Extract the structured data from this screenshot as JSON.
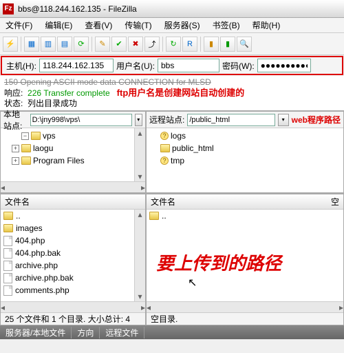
{
  "title": "bbs@118.244.162.135 - FileZilla",
  "menu": [
    "文件(F)",
    "编辑(E)",
    "查看(V)",
    "传输(T)",
    "服务器(S)",
    "书签(B)",
    "帮助(H)"
  ],
  "conn": {
    "host_label": "主机(H):",
    "host": "118.244.162.135",
    "user_label": "用户名(U):",
    "user": "bbs",
    "pass_label": "密码(W):",
    "pass": "●●●●●●●●●●"
  },
  "log": {
    "line1": "150 Opening ASCII mode data CONNECTION for MLSD",
    "line2_label": "响应:",
    "line2": "226 Transfer complete",
    "line3_label": "状态:",
    "line3": "列出目录成功",
    "anno1": "ftp用户名是创建网站自动创建的"
  },
  "local": {
    "label": "本地站点:",
    "path": "D:\\jny998\\vps\\",
    "tree": [
      "vps",
      "laogu",
      "Program Files"
    ]
  },
  "remote": {
    "label": "远程站点:",
    "path": "/public_html",
    "anno": "web程序路径",
    "tree": [
      "logs",
      "public_html",
      "tmp"
    ]
  },
  "filehdr": "文件名",
  "localfiles": [
    "..",
    "images",
    "404.php",
    "404.php.bak",
    "archive.php",
    "archive.php.bak",
    "comments.php"
  ],
  "localstatus": "25 个文件和 1 个目录. 大小总计: 4",
  "remotefiles": [
    ".."
  ],
  "remotestatus": "空目录.",
  "rightcol": "空",
  "bigred": "要上传到的路径",
  "bottom": [
    "服务器/本地文件",
    "方向",
    "远程文件"
  ]
}
